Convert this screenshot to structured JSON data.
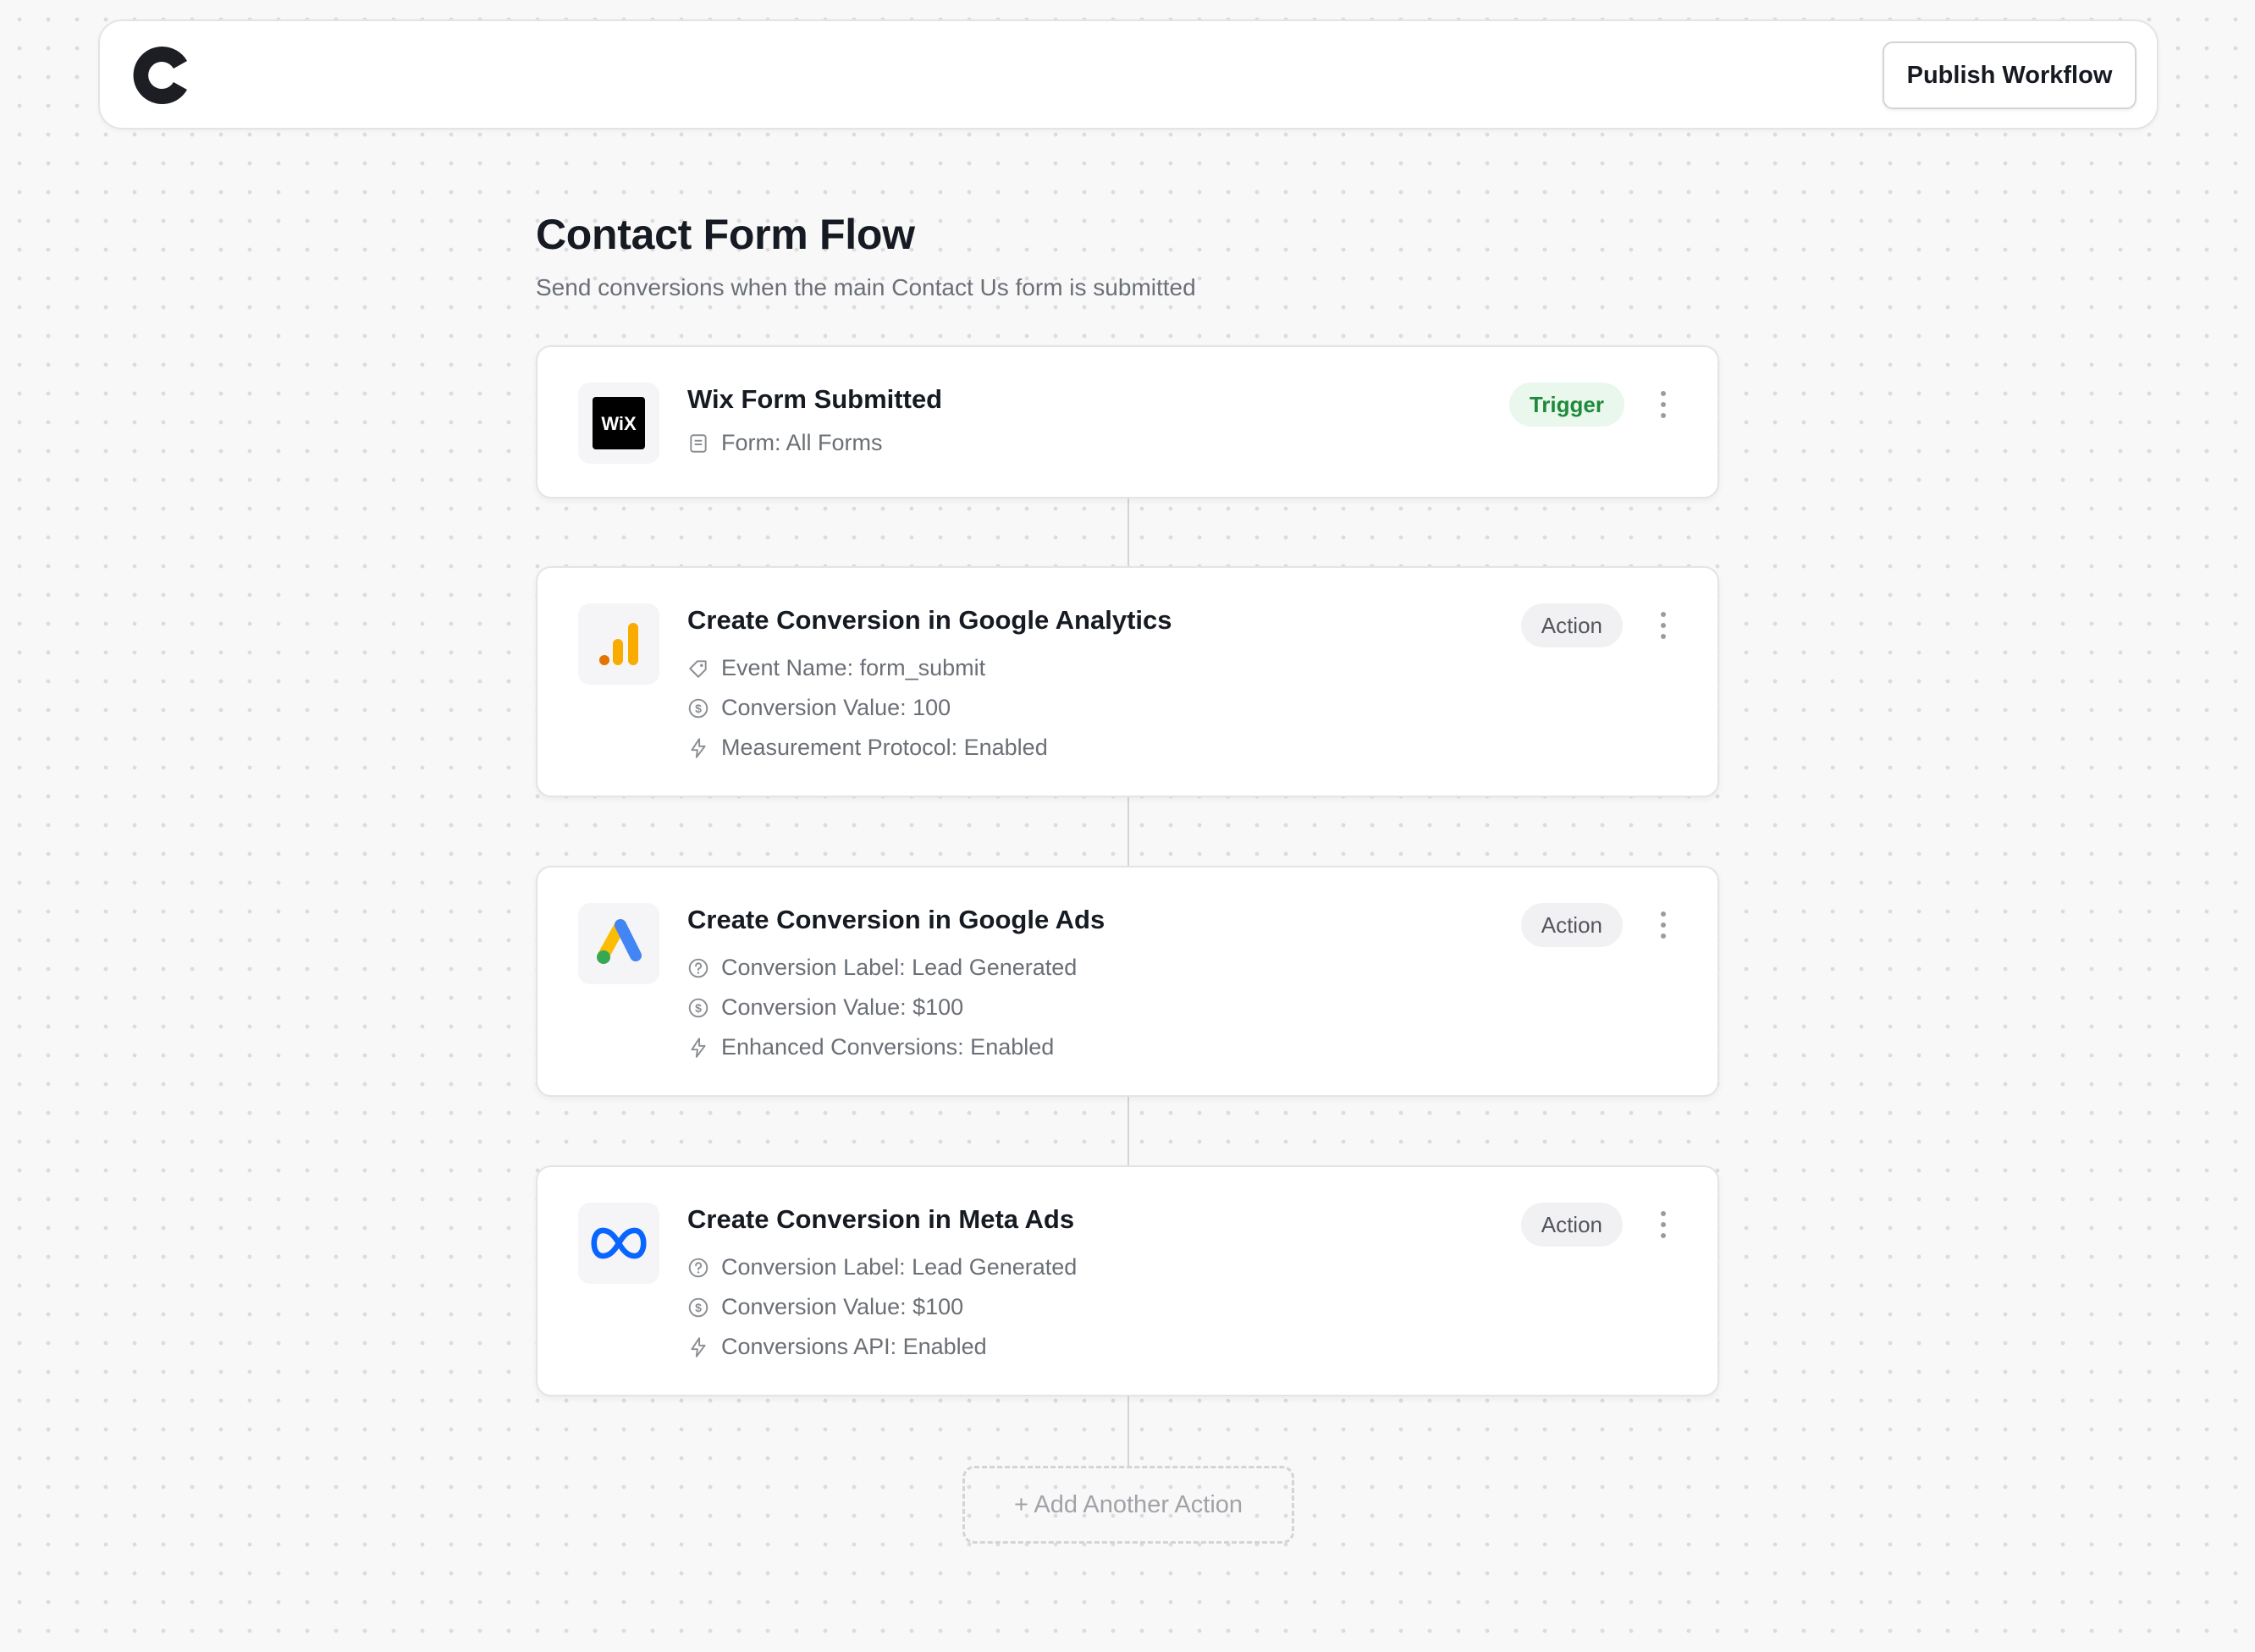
{
  "header": {
    "logo_icon": "brand-c-logo-icon",
    "publish_label": "Publish Workflow"
  },
  "workflow": {
    "title": "Contact Form Flow",
    "subtitle": "Send conversions when the main Contact Us form is submitted"
  },
  "steps": [
    {
      "app_icon": "wix-logo-icon",
      "title": "Wix Form Submitted",
      "badge": "Trigger",
      "details": [
        {
          "icon": "form-icon",
          "text": "Form: All Forms"
        }
      ]
    },
    {
      "app_icon": "google-analytics-icon",
      "title": "Create Conversion in Google Analytics",
      "badge": "Action",
      "details": [
        {
          "icon": "tag-icon",
          "text": "Event Name: form_submit"
        },
        {
          "icon": "dollar-circle-icon",
          "text": "Conversion Value: 100"
        },
        {
          "icon": "lightning-icon",
          "text": "Measurement Protocol: Enabled"
        }
      ]
    },
    {
      "app_icon": "google-ads-icon",
      "title": "Create Conversion in Google Ads",
      "badge": "Action",
      "details": [
        {
          "icon": "help-circle-icon",
          "text": "Conversion Label: Lead Generated"
        },
        {
          "icon": "dollar-circle-icon",
          "text": "Conversion Value: $100"
        },
        {
          "icon": "lightning-icon",
          "text": "Enhanced Conversions: Enabled"
        }
      ]
    },
    {
      "app_icon": "meta-logo-icon",
      "title": "Create Conversion in Meta Ads",
      "badge": "Action",
      "details": [
        {
          "icon": "help-circle-icon",
          "text": "Conversion Label: Lead Generated"
        },
        {
          "icon": "dollar-circle-icon",
          "text": "Conversion Value: $100"
        },
        {
          "icon": "lightning-icon",
          "text": "Conversions API: Enabled"
        }
      ]
    }
  ],
  "add_action_label": "+ Add Another Action",
  "colors": {
    "trigger_badge_bg": "#eaf7ec",
    "trigger_badge_text": "#1f8a3b",
    "action_badge_bg": "#f1f1f3",
    "meta_blue": "#0866ff",
    "analytics_orange": "#f9ab00",
    "ads_blue": "#4285f4",
    "ads_yellow": "#fbbc04",
    "ads_green": "#34a853"
  }
}
